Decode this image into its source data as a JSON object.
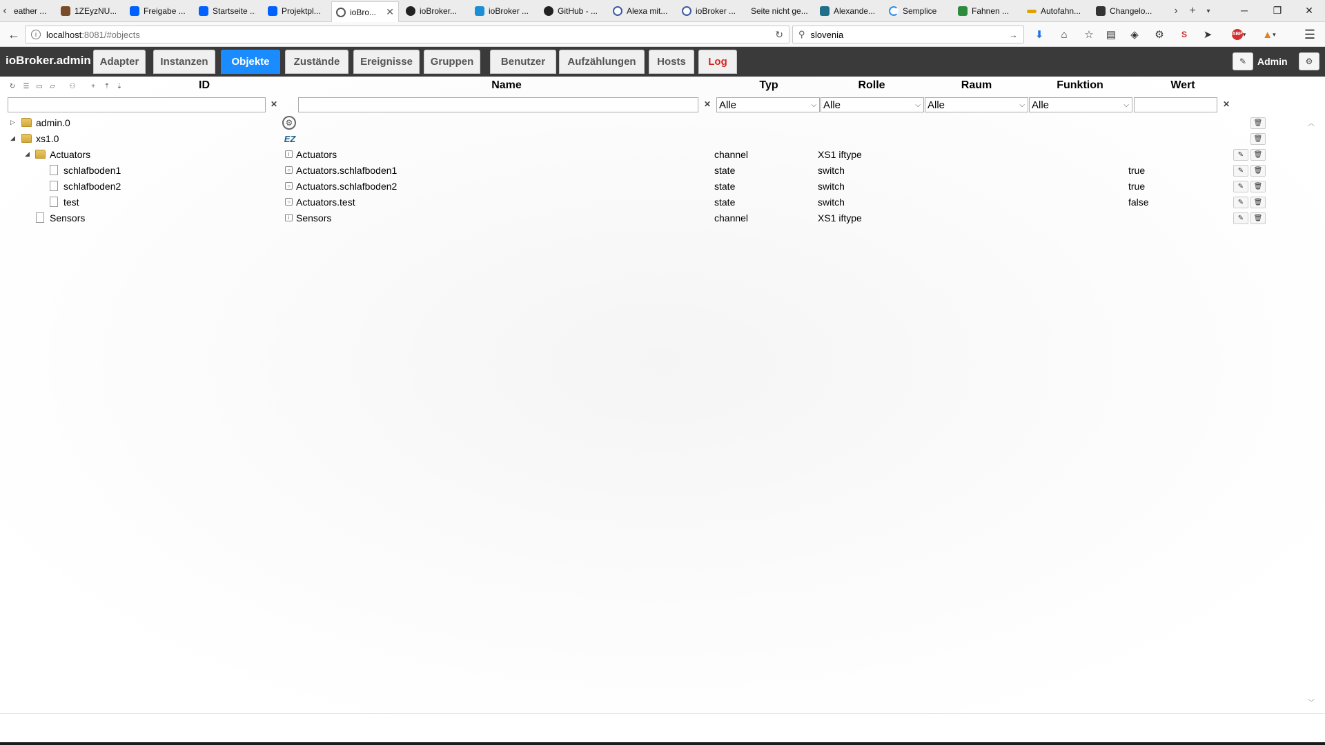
{
  "browser": {
    "tabs": [
      {
        "label": "eather ...",
        "color": "#d8d8d8"
      },
      {
        "label": "1ZEyzNU...",
        "color": "#7a4b2a"
      },
      {
        "label": "Freigabe ...",
        "color": "#0061fe"
      },
      {
        "label": "Startseite ...",
        "color": "#0061fe"
      },
      {
        "label": "Projektpl...",
        "color": "#0061fe"
      },
      {
        "label": "ioBro...",
        "color": "#555555"
      },
      {
        "label": "ioBroker...",
        "color": "#222222"
      },
      {
        "label": "ioBroker ...",
        "color": "#1a8fd6"
      },
      {
        "label": "GitHub - ...",
        "color": "#222222"
      },
      {
        "label": "Alexa mit...",
        "color": "#3a5ba0"
      },
      {
        "label": "ioBroker ...",
        "color": "#3a5ba0"
      },
      {
        "label": "Seite nicht ge...",
        "color": "#ffffff"
      },
      {
        "label": "Alexande...",
        "color": "#1f6f8b"
      },
      {
        "label": "Semplice",
        "color": "#2b8fe8"
      },
      {
        "label": "Fahnen ...",
        "color": "#2e8b3e"
      },
      {
        "label": "Autofahn...",
        "color": "#e0a000"
      },
      {
        "label": "Changelo...",
        "color": "#333333"
      }
    ],
    "url_host": "localhost",
    "url_path": ":8081/#objects",
    "search_value": "slovenia"
  },
  "app": {
    "brand": "ioBroker.admin",
    "tabs": [
      "Adapter",
      "Instanzen",
      "Objekte",
      "Zustände",
      "Ereignisse",
      "Gruppen",
      "Benutzer",
      "Aufzählungen",
      "Hosts",
      "Log"
    ],
    "active_tab": "Objekte",
    "user": "Admin",
    "accent_color": "#1a8cff",
    "log_color": "#d42424"
  },
  "columns": {
    "id": "ID",
    "name": "Name",
    "type": "Typ",
    "role": "Rolle",
    "room": "Raum",
    "function": "Funktion",
    "value": "Wert"
  },
  "filters": {
    "type": "Alle",
    "role": "Alle",
    "room": "Alle",
    "function": "Alle"
  },
  "rows": [
    {
      "id": "admin.0",
      "name": "",
      "type": "",
      "role": "",
      "value": ""
    },
    {
      "id": "xs1.0",
      "name": "",
      "type": "",
      "role": "",
      "value": ""
    },
    {
      "id": "Actuators",
      "name": "Actuators",
      "type": "channel",
      "role": "XS1 iftype",
      "value": ""
    },
    {
      "id": "schlafboden1",
      "name": "Actuators.schlafboden1",
      "type": "state",
      "role": "switch",
      "value": "true"
    },
    {
      "id": "schlafboden2",
      "name": "Actuators.schlafboden2",
      "type": "state",
      "role": "switch",
      "value": "true"
    },
    {
      "id": "test",
      "name": "Actuators.test",
      "type": "state",
      "role": "switch",
      "value": "false"
    },
    {
      "id": "Sensors",
      "name": "Sensors",
      "type": "channel",
      "role": "XS1 iftype",
      "value": ""
    }
  ],
  "icons": {
    "admin_logo": "gear-icon",
    "xs1_logo": "ez-control-logo"
  }
}
